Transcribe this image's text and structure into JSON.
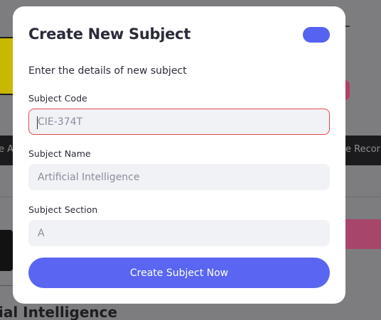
{
  "background": {
    "bar_left_text": "e A",
    "bar_right_text": "e Recor",
    "bottom_text": "ial Intelligence"
  },
  "modal": {
    "title": "Create New Subject",
    "subtitle": "Enter the details of new subject",
    "fields": [
      {
        "label": "Subject Code",
        "placeholder": "CIE-374T",
        "value": ""
      },
      {
        "label": "Subject Name",
        "placeholder": "Artificial Intelligence",
        "value": ""
      },
      {
        "label": "Subject Section",
        "placeholder": "A",
        "value": ""
      }
    ],
    "submit_label": "Create Subject Now"
  },
  "colors": {
    "accent": "#5a66f2",
    "focus_border": "#e04a4a",
    "backdrop": "#7d7d80"
  }
}
